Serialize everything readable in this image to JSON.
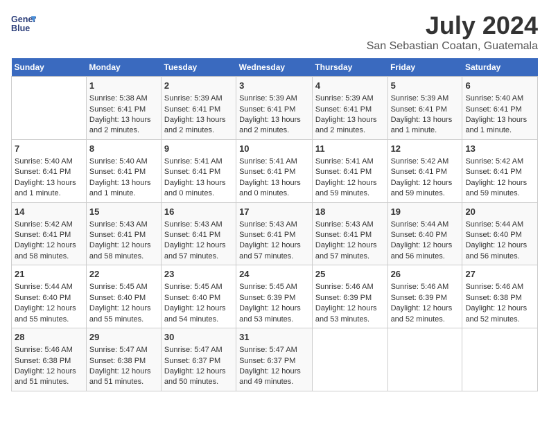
{
  "logo": {
    "line1": "General",
    "line2": "Blue"
  },
  "title": "July 2024",
  "subtitle": "San Sebastian Coatan, Guatemala",
  "days_of_week": [
    "Sunday",
    "Monday",
    "Tuesday",
    "Wednesday",
    "Thursday",
    "Friday",
    "Saturday"
  ],
  "weeks": [
    [
      {
        "day": "",
        "sunrise": "",
        "sunset": "",
        "daylight": ""
      },
      {
        "day": "1",
        "sunrise": "Sunrise: 5:38 AM",
        "sunset": "Sunset: 6:41 PM",
        "daylight": "Daylight: 13 hours and 2 minutes."
      },
      {
        "day": "2",
        "sunrise": "Sunrise: 5:39 AM",
        "sunset": "Sunset: 6:41 PM",
        "daylight": "Daylight: 13 hours and 2 minutes."
      },
      {
        "day": "3",
        "sunrise": "Sunrise: 5:39 AM",
        "sunset": "Sunset: 6:41 PM",
        "daylight": "Daylight: 13 hours and 2 minutes."
      },
      {
        "day": "4",
        "sunrise": "Sunrise: 5:39 AM",
        "sunset": "Sunset: 6:41 PM",
        "daylight": "Daylight: 13 hours and 2 minutes."
      },
      {
        "day": "5",
        "sunrise": "Sunrise: 5:39 AM",
        "sunset": "Sunset: 6:41 PM",
        "daylight": "Daylight: 13 hours and 1 minute."
      },
      {
        "day": "6",
        "sunrise": "Sunrise: 5:40 AM",
        "sunset": "Sunset: 6:41 PM",
        "daylight": "Daylight: 13 hours and 1 minute."
      }
    ],
    [
      {
        "day": "7",
        "sunrise": "Sunrise: 5:40 AM",
        "sunset": "Sunset: 6:41 PM",
        "daylight": "Daylight: 13 hours and 1 minute."
      },
      {
        "day": "8",
        "sunrise": "Sunrise: 5:40 AM",
        "sunset": "Sunset: 6:41 PM",
        "daylight": "Daylight: 13 hours and 1 minute."
      },
      {
        "day": "9",
        "sunrise": "Sunrise: 5:41 AM",
        "sunset": "Sunset: 6:41 PM",
        "daylight": "Daylight: 13 hours and 0 minutes."
      },
      {
        "day": "10",
        "sunrise": "Sunrise: 5:41 AM",
        "sunset": "Sunset: 6:41 PM",
        "daylight": "Daylight: 13 hours and 0 minutes."
      },
      {
        "day": "11",
        "sunrise": "Sunrise: 5:41 AM",
        "sunset": "Sunset: 6:41 PM",
        "daylight": "Daylight: 12 hours and 59 minutes."
      },
      {
        "day": "12",
        "sunrise": "Sunrise: 5:42 AM",
        "sunset": "Sunset: 6:41 PM",
        "daylight": "Daylight: 12 hours and 59 minutes."
      },
      {
        "day": "13",
        "sunrise": "Sunrise: 5:42 AM",
        "sunset": "Sunset: 6:41 PM",
        "daylight": "Daylight: 12 hours and 59 minutes."
      }
    ],
    [
      {
        "day": "14",
        "sunrise": "Sunrise: 5:42 AM",
        "sunset": "Sunset: 6:41 PM",
        "daylight": "Daylight: 12 hours and 58 minutes."
      },
      {
        "day": "15",
        "sunrise": "Sunrise: 5:43 AM",
        "sunset": "Sunset: 6:41 PM",
        "daylight": "Daylight: 12 hours and 58 minutes."
      },
      {
        "day": "16",
        "sunrise": "Sunrise: 5:43 AM",
        "sunset": "Sunset: 6:41 PM",
        "daylight": "Daylight: 12 hours and 57 minutes."
      },
      {
        "day": "17",
        "sunrise": "Sunrise: 5:43 AM",
        "sunset": "Sunset: 6:41 PM",
        "daylight": "Daylight: 12 hours and 57 minutes."
      },
      {
        "day": "18",
        "sunrise": "Sunrise: 5:43 AM",
        "sunset": "Sunset: 6:41 PM",
        "daylight": "Daylight: 12 hours and 57 minutes."
      },
      {
        "day": "19",
        "sunrise": "Sunrise: 5:44 AM",
        "sunset": "Sunset: 6:40 PM",
        "daylight": "Daylight: 12 hours and 56 minutes."
      },
      {
        "day": "20",
        "sunrise": "Sunrise: 5:44 AM",
        "sunset": "Sunset: 6:40 PM",
        "daylight": "Daylight: 12 hours and 56 minutes."
      }
    ],
    [
      {
        "day": "21",
        "sunrise": "Sunrise: 5:44 AM",
        "sunset": "Sunset: 6:40 PM",
        "daylight": "Daylight: 12 hours and 55 minutes."
      },
      {
        "day": "22",
        "sunrise": "Sunrise: 5:45 AM",
        "sunset": "Sunset: 6:40 PM",
        "daylight": "Daylight: 12 hours and 55 minutes."
      },
      {
        "day": "23",
        "sunrise": "Sunrise: 5:45 AM",
        "sunset": "Sunset: 6:40 PM",
        "daylight": "Daylight: 12 hours and 54 minutes."
      },
      {
        "day": "24",
        "sunrise": "Sunrise: 5:45 AM",
        "sunset": "Sunset: 6:39 PM",
        "daylight": "Daylight: 12 hours and 53 minutes."
      },
      {
        "day": "25",
        "sunrise": "Sunrise: 5:46 AM",
        "sunset": "Sunset: 6:39 PM",
        "daylight": "Daylight: 12 hours and 53 minutes."
      },
      {
        "day": "26",
        "sunrise": "Sunrise: 5:46 AM",
        "sunset": "Sunset: 6:39 PM",
        "daylight": "Daylight: 12 hours and 52 minutes."
      },
      {
        "day": "27",
        "sunrise": "Sunrise: 5:46 AM",
        "sunset": "Sunset: 6:38 PM",
        "daylight": "Daylight: 12 hours and 52 minutes."
      }
    ],
    [
      {
        "day": "28",
        "sunrise": "Sunrise: 5:46 AM",
        "sunset": "Sunset: 6:38 PM",
        "daylight": "Daylight: 12 hours and 51 minutes."
      },
      {
        "day": "29",
        "sunrise": "Sunrise: 5:47 AM",
        "sunset": "Sunset: 6:38 PM",
        "daylight": "Daylight: 12 hours and 51 minutes."
      },
      {
        "day": "30",
        "sunrise": "Sunrise: 5:47 AM",
        "sunset": "Sunset: 6:37 PM",
        "daylight": "Daylight: 12 hours and 50 minutes."
      },
      {
        "day": "31",
        "sunrise": "Sunrise: 5:47 AM",
        "sunset": "Sunset: 6:37 PM",
        "daylight": "Daylight: 12 hours and 49 minutes."
      },
      {
        "day": "",
        "sunrise": "",
        "sunset": "",
        "daylight": ""
      },
      {
        "day": "",
        "sunrise": "",
        "sunset": "",
        "daylight": ""
      },
      {
        "day": "",
        "sunrise": "",
        "sunset": "",
        "daylight": ""
      }
    ]
  ]
}
